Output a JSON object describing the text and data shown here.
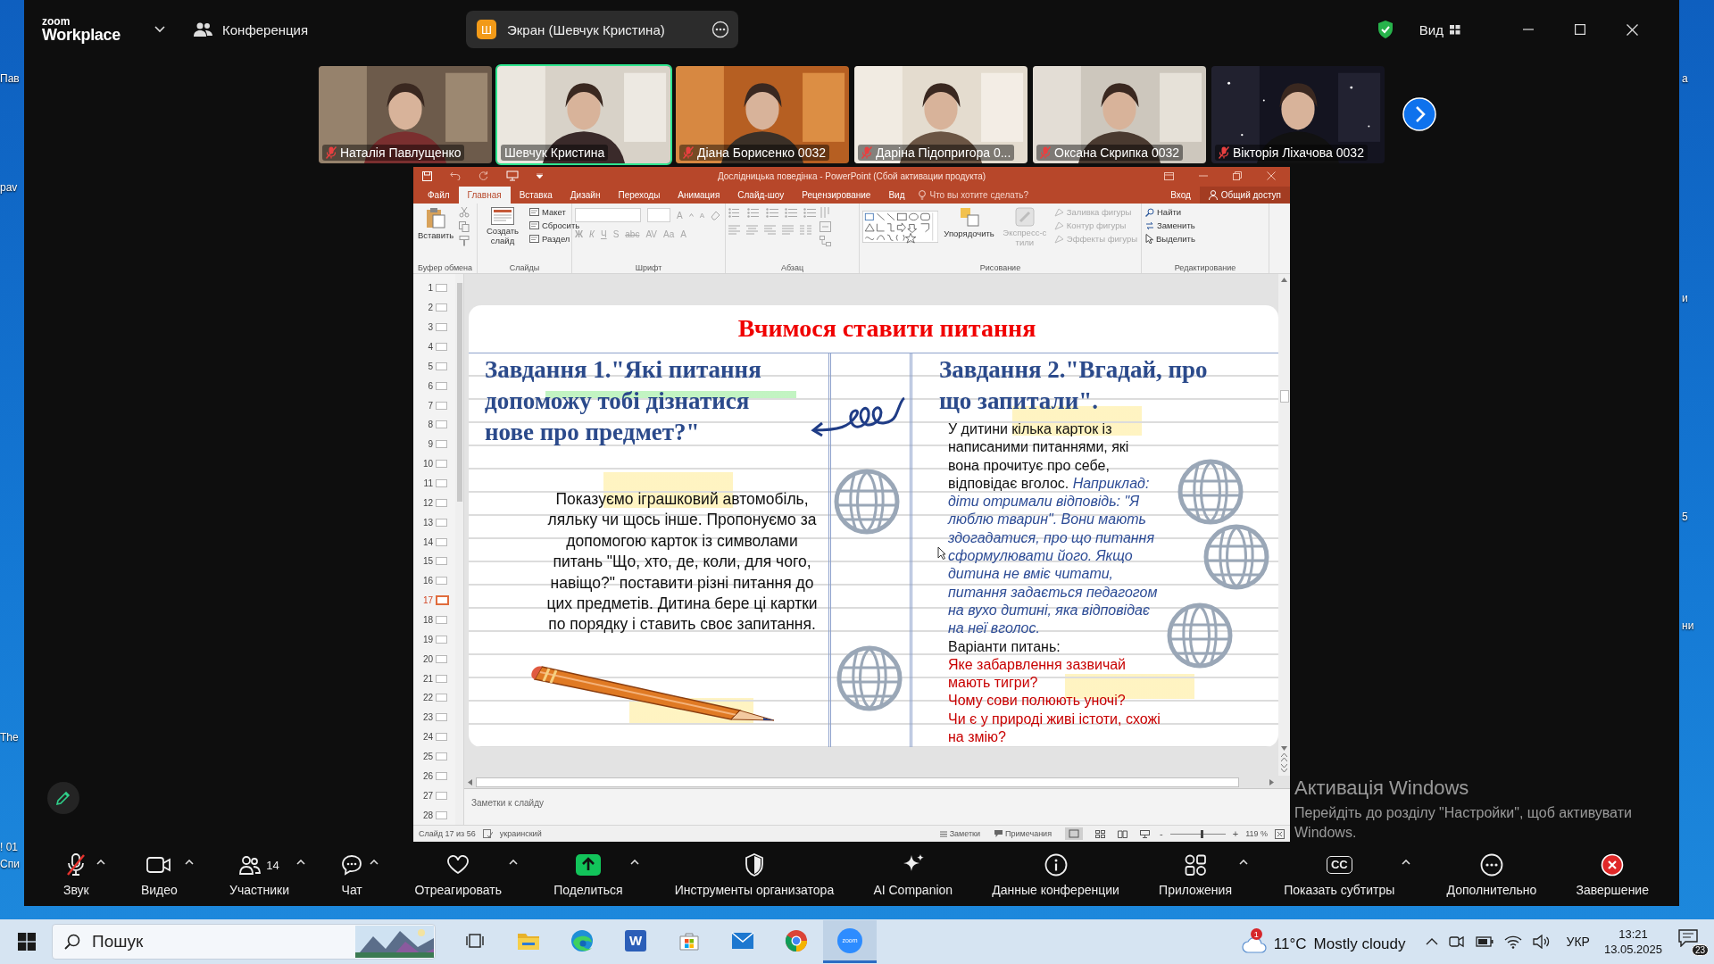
{
  "desktop": {
    "left_labels": [
      "Пав",
      "pav",
      "The",
      "! 01",
      "Спи"
    ],
    "right_labels": [
      "а",
      "и",
      "5",
      "ни"
    ]
  },
  "zoom": {
    "logo_top": "zoom",
    "logo_bottom": "Workplace",
    "meeting_button": "Конференция",
    "share_badge": "Ш",
    "share_label": "Экран (Шевчук Кристина)",
    "view_button": "Вид"
  },
  "participants": [
    {
      "name": "Наталія Павлущенко",
      "muted": true,
      "speaking": false
    },
    {
      "name": "Шевчук Кристина",
      "muted": false,
      "speaking": true
    },
    {
      "name": "Діана Борисенко 0032",
      "muted": true,
      "speaking": false
    },
    {
      "name": "Даріна Підопригора 0...",
      "muted": true,
      "speaking": false
    },
    {
      "name": "Оксана Скрипка 0032",
      "muted": true,
      "speaking": false
    },
    {
      "name": "Вікторія Ліхачова 0032",
      "muted": true,
      "speaking": false
    }
  ],
  "powerpoint": {
    "title": "Дослідницька поведінка - PowerPoint (Сбой активации продукта)",
    "tabs": [
      {
        "label": "Файл",
        "selected": false
      },
      {
        "label": "Главная",
        "selected": true
      },
      {
        "label": "Вставка",
        "selected": false
      },
      {
        "label": "Дизайн",
        "selected": false
      },
      {
        "label": "Переходы",
        "selected": false
      },
      {
        "label": "Анимация",
        "selected": false
      },
      {
        "label": "Слайд-шоу",
        "selected": false
      },
      {
        "label": "Рецензирование",
        "selected": false
      },
      {
        "label": "Вид",
        "selected": false
      }
    ],
    "tell_me": "Что вы хотите сделать?",
    "sign_in": "Вход",
    "share": "Общий доступ",
    "ribbon": [
      {
        "kind": "clipboard",
        "label": "Буфер обмена",
        "items": [
          "Вставить"
        ]
      },
      {
        "kind": "slides",
        "label": "Слайды",
        "items": [
          "Создать слайд",
          "Макет",
          "Сбросить",
          "Раздел"
        ]
      },
      {
        "kind": "font",
        "label": "Шрифт",
        "items": [
          "A",
          "A",
          "Ж",
          "К",
          "Ч",
          "S",
          "abc",
          "AV",
          "Aa",
          "A"
        ]
      },
      {
        "kind": "paragraph",
        "label": "Абзац"
      },
      {
        "kind": "drawing",
        "label": "Рисование",
        "items": [
          {
            "label": "Упорядочить",
            "disabled": false
          },
          {
            "label": "Экспресс-стили",
            "disabled": true
          },
          {
            "label": "Заливка фигуры",
            "disabled": true
          },
          {
            "label": "Контур фигуры",
            "disabled": true
          },
          {
            "label": "Эффекты фигуры",
            "disabled": true
          }
        ]
      },
      {
        "kind": "editing",
        "label": "Редактирование",
        "items": [
          "Найти",
          "Заменить",
          "Выделить"
        ]
      }
    ],
    "thumbnails": [
      {
        "number": "1",
        "selected": false
      },
      {
        "number": "2",
        "selected": false
      },
      {
        "number": "3",
        "selected": false
      },
      {
        "number": "4",
        "selected": false
      },
      {
        "number": "5",
        "selected": false
      },
      {
        "number": "6",
        "selected": false
      },
      {
        "number": "7",
        "selected": false
      },
      {
        "number": "8",
        "selected": false
      },
      {
        "number": "9",
        "selected": false
      },
      {
        "number": "10",
        "selected": false
      },
      {
        "number": "11",
        "selected": false
      },
      {
        "number": "12",
        "selected": false
      },
      {
        "number": "13",
        "selected": false
      },
      {
        "number": "14",
        "selected": false
      },
      {
        "number": "15",
        "selected": false
      },
      {
        "number": "16",
        "selected": false
      },
      {
        "number": "17",
        "selected": true
      },
      {
        "number": "18",
        "selected": false
      },
      {
        "number": "19",
        "selected": false
      },
      {
        "number": "20",
        "selected": false
      },
      {
        "number": "21",
        "selected": false
      },
      {
        "number": "22",
        "selected": false
      },
      {
        "number": "23",
        "selected": false
      },
      {
        "number": "24",
        "selected": false
      },
      {
        "number": "25",
        "selected": false
      },
      {
        "number": "26",
        "selected": false
      },
      {
        "number": "27",
        "selected": false
      },
      {
        "number": "28",
        "selected": false
      }
    ],
    "slide": {
      "title": "Вчимося ставити питання",
      "task1": {
        "heading": "Завдання 1.\"Які питання допоможу тобі дізнатися нове про предмет?\"",
        "body": "Показуємо іграшковий автомобіль, ляльку чи щось інше. Пропонуємо за допомогою карток із символами питань \"Що, хто, де, коли, для чого, навіщо?\" поставити різні питання до цих предметів. Дитина бере ці картки по порядку і ставить своє запитання."
      },
      "task2": {
        "heading": "Завдання 2.\"Вгадай, про що запитали\".",
        "body": "У дитини кілька карток із написаними питаннями, які вона прочитує про себе, відповідає вголос. *Наприклад: діти отримали відповідь: \"Я люблю тварин\". Вони мають здогадатися, про що питання сформулювати його. Якщо дитина не вміє читати, питання задається педагогом на вухо дитині, яка відповідає на неї вголос.*",
        "variants_label": "Варіанти питань:",
        "questions": [
          "Яке забарвлення зазвичай мають тигри?",
          "Чому сови полюють уночі?",
          "Чи є у природі живі істоти, схожі на змію?"
        ]
      }
    },
    "notes_placeholder": "Заметки к слайду",
    "status_bar": {
      "slide_counter": "Слайд 17 из 56",
      "language": "украинский",
      "notes_button": "Заметки",
      "comments_button": "Примечания",
      "zoom_out": "-",
      "zoom_in": "+",
      "zoom_slider": {
        "level": 0.55
      },
      "zoom_percent": "119 %"
    }
  },
  "toolbar": [
    {
      "kind": "mic-muted",
      "label": "Звук",
      "has_menu": true
    },
    {
      "kind": "video",
      "label": "Видео",
      "has_menu": true
    },
    {
      "kind": "participants",
      "label": "Участники",
      "count": "14",
      "has_menu": true
    },
    {
      "kind": "chat",
      "label": "Чат",
      "has_menu": true
    },
    {
      "kind": "react",
      "label": "Отреагировать",
      "has_menu": true
    },
    {
      "kind": "share",
      "label": "Поделиться",
      "has_menu": true
    },
    {
      "kind": "host-tools",
      "label": "Инструменты организатора",
      "has_menu": false
    },
    {
      "kind": "ai",
      "label": "AI Companion",
      "has_menu": false
    },
    {
      "kind": "info",
      "label": "Данные конференции",
      "has_menu": false
    },
    {
      "kind": "apps",
      "label": "Приложения",
      "has_menu": true
    },
    {
      "kind": "captions",
      "label": "Показать субтитры",
      "icon_text": "CC",
      "has_menu": true
    },
    {
      "kind": "more",
      "label": "Дополнительно",
      "has_menu": false
    },
    {
      "kind": "end",
      "label": "Завершение",
      "has_menu": false
    }
  ],
  "activation_notice": {
    "title": "Активація Windows",
    "text": "Перейдіть до розділу \"Настройки\", щоб активувати Windows."
  },
  "taskbar": {
    "search_placeholder": "Пошук",
    "apps": [
      {
        "kind": "task-view",
        "active": false
      },
      {
        "kind": "folder",
        "active": false
      },
      {
        "kind": "edge",
        "active": false
      },
      {
        "kind": "word",
        "icon_text": "W",
        "active": false
      },
      {
        "kind": "store",
        "active": false
      },
      {
        "kind": "mail",
        "active": false
      },
      {
        "kind": "chrome",
        "active": false
      },
      {
        "kind": "zoom",
        "icon_text": "zoom",
        "active": true
      }
    ],
    "weather_badge": "1",
    "temperature": "11°C",
    "condition": "Mostly cloudy",
    "language": "УКР",
    "time": "13:21",
    "date": "13.05.2025",
    "notifications": "23"
  }
}
